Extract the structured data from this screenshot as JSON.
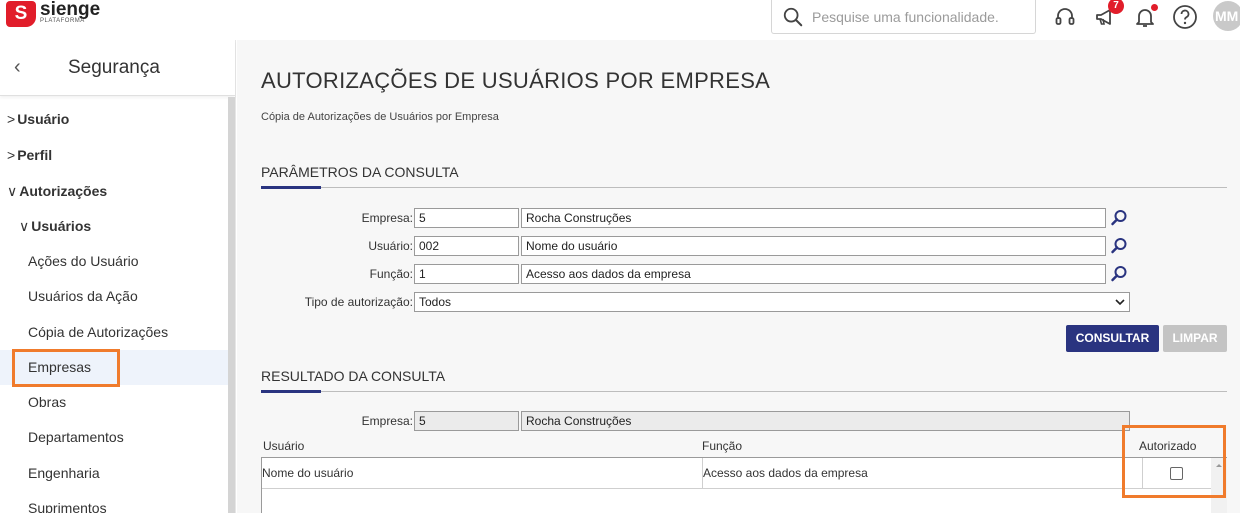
{
  "brand": {
    "name": "sienge",
    "tagline": "PLATAFORMA",
    "accent": "#e11d2a"
  },
  "topbar": {
    "search_placeholder": "Pesquise uma funcionalidade.",
    "notifications_badge": "7",
    "avatar_initials": "MM"
  },
  "sidebar": {
    "title": "Segurança",
    "items": [
      {
        "label": "Usuário",
        "level": 0,
        "expanded": false
      },
      {
        "label": "Perfil",
        "level": 0,
        "expanded": false
      },
      {
        "label": "Autorizações",
        "level": 0,
        "expanded": true
      },
      {
        "label": "Usuários",
        "level": 1,
        "expanded": true
      },
      {
        "label": "Ações do Usuário",
        "level": 2
      },
      {
        "label": "Usuários da Ação",
        "level": 2
      },
      {
        "label": "Cópia de Autorizações",
        "level": 2
      },
      {
        "label": "Empresas",
        "level": 2,
        "active": true
      },
      {
        "label": "Obras",
        "level": 2
      },
      {
        "label": "Departamentos",
        "level": 2
      },
      {
        "label": "Engenharia",
        "level": 2
      },
      {
        "label": "Suprimentos",
        "level": 2
      }
    ]
  },
  "page": {
    "title": "AUTORIZAÇÕES DE USUÁRIOS POR EMPRESA",
    "subtitle": "Cópia de Autorizações de Usuários por Empresa"
  },
  "params": {
    "section_title": "PARÂMETROS DA CONSULTA",
    "empresa": {
      "label": "Empresa:",
      "code": "5",
      "name": "Rocha Construções"
    },
    "usuario": {
      "label": "Usuário:",
      "code": "002",
      "name": "Nome do usuário"
    },
    "funcao": {
      "label": "Função:",
      "code": "1",
      "name": "Acesso aos dados da empresa"
    },
    "tipo": {
      "label": "Tipo de autorização:",
      "value": "Todos"
    },
    "consultar_label": "CONSULTAR",
    "limpar_label": "LIMPAR"
  },
  "result": {
    "section_title": "RESULTADO DA CONSULTA",
    "empresa": {
      "label": "Empresa:",
      "code": "5",
      "name": "Rocha Construções"
    },
    "columns": [
      "Usuário",
      "Função",
      "Autorizado"
    ],
    "rows": [
      {
        "usuario": "Nome do usuário",
        "funcao": "Acesso aos dados da empresa",
        "autorizado": false
      }
    ]
  },
  "colors": {
    "primary": "#2a3480",
    "highlight": "#f07b2c"
  }
}
